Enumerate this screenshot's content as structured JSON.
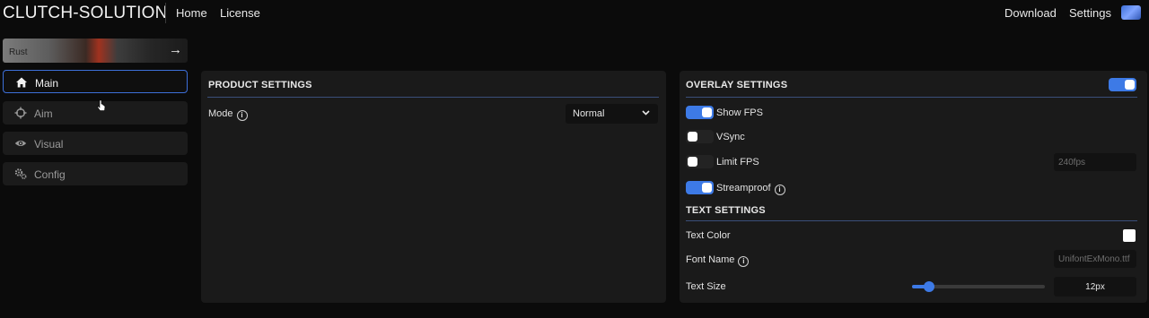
{
  "header": {
    "brand": "CLUTCH-SOLUTION",
    "nav_left": [
      "Home",
      "License"
    ],
    "nav_right": [
      "Download",
      "Settings"
    ]
  },
  "game": {
    "label": "Rust"
  },
  "sidebar": {
    "items": [
      {
        "label": "Main",
        "icon": "home-icon",
        "active": true
      },
      {
        "label": "Aim",
        "icon": "crosshair-icon",
        "active": false
      },
      {
        "label": "Visual",
        "icon": "eye-icon",
        "active": false
      },
      {
        "label": "Config",
        "icon": "gears-icon",
        "active": false
      }
    ]
  },
  "product": {
    "title": "PRODUCT SETTINGS",
    "mode_label": "Mode",
    "mode_value": "Normal"
  },
  "overlay": {
    "title": "OVERLAY SETTINGS",
    "enabled": true,
    "show_fps": {
      "label": "Show FPS",
      "on": true
    },
    "vsync": {
      "label": "VSync",
      "on": false
    },
    "limit_fps": {
      "label": "Limit FPS",
      "on": false,
      "value": "240fps"
    },
    "streamproof": {
      "label": "Streamproof",
      "on": true
    }
  },
  "text_settings": {
    "title": "TEXT SETTINGS",
    "text_color_label": "Text Color",
    "text_color": "#ffffff",
    "font_name_label": "Font Name",
    "font_name_value": "UnifontExMono.ttf",
    "text_size_label": "Text Size",
    "text_size_value": "12px",
    "text_size_fraction": 0.13
  },
  "colors": {
    "accent": "#3d7ae6",
    "panel": "#1a1a1a",
    "background": "#0b0b0b"
  }
}
